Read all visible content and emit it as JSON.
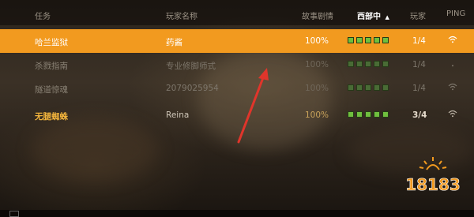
{
  "header": {
    "col_mission": "任务",
    "col_player_name": "玩家名称",
    "col_story_progress": "故事剧情",
    "col_region": "西部中",
    "col_region_sort": "▲",
    "col_players": "玩家",
    "col_ping": "PING"
  },
  "rows": [
    {
      "mission": "哈兰监狱",
      "player": "药酱",
      "progress": "100%",
      "signal": 5,
      "players": "1/4",
      "selected": true
    },
    {
      "mission": "杀戮指南",
      "player": "专业修脚师式",
      "progress": "100%",
      "signal": 5,
      "players": "1/4",
      "selected": false
    },
    {
      "mission": "隧道惊魂",
      "player": "2079025954",
      "progress": "100%",
      "signal": 5,
      "players": "1/4",
      "selected": false
    },
    {
      "mission": "无腿蜘蛛",
      "player": "Reina",
      "progress": "100%",
      "signal": 5,
      "players": "3/4",
      "selected": false
    }
  ],
  "colors": {
    "selected_row": "#f29a1f",
    "signal_green": "#6fbf3e",
    "mission_gold": "#f2b43c",
    "annotation_arrow": "#e0352b"
  },
  "icons": {
    "ping": "wifi-icon",
    "signal": "signal-bars-icon",
    "annotation": "red-arrow-icon",
    "watermark": "site-logo"
  },
  "watermark": {
    "text": "18183"
  }
}
